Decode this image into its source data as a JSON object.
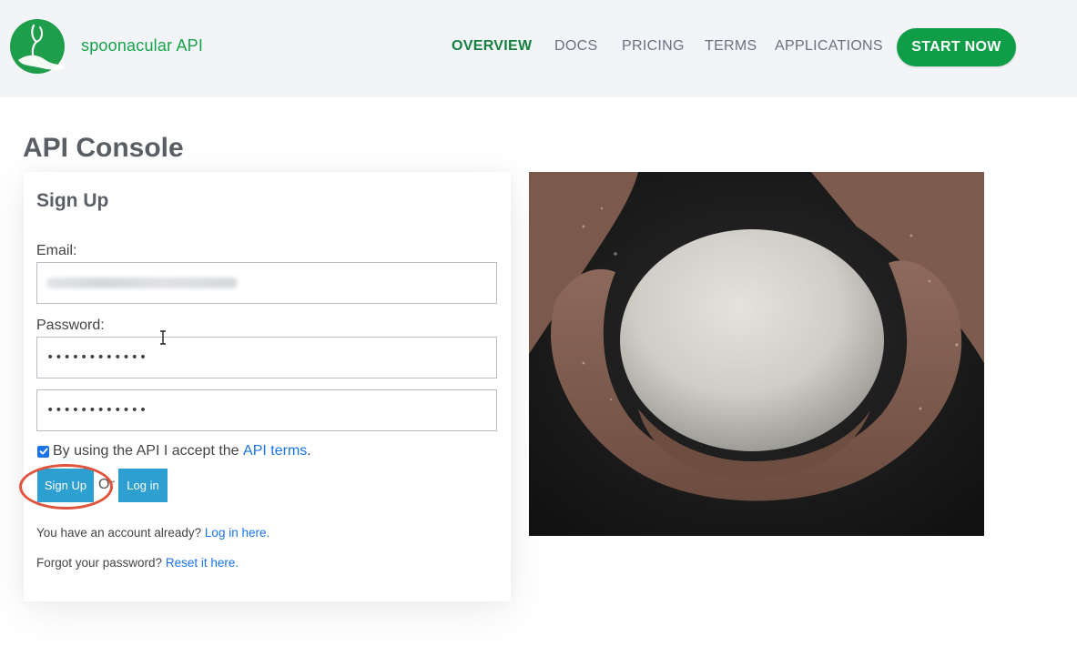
{
  "header": {
    "brand": "spoonacular API",
    "nav": [
      {
        "label": "OVERVIEW",
        "active": true
      },
      {
        "label": "DOCS",
        "active": false
      },
      {
        "label": "PRICING",
        "active": false
      },
      {
        "label": "TERMS",
        "active": false
      },
      {
        "label": "APPLICATIONS",
        "active": false
      }
    ],
    "cta_label": "START NOW"
  },
  "page": {
    "title": "API Console"
  },
  "signup": {
    "title": "Sign Up",
    "email_label": "Email:",
    "email_value_blurred": true,
    "password_label": "Password:",
    "password_value": "••••••••••••",
    "password_confirm_value": "••••••••••••",
    "terms_checked": true,
    "terms_text": "By using the API I accept the",
    "terms_link": "API terms",
    "terms_period": ".",
    "signup_button": "Sign Up",
    "or_text": "Or",
    "login_button": "Log in",
    "have_account_text": "You have an account already?",
    "have_account_link": "Log in here.",
    "forgot_text": "Forgot your password?",
    "forgot_link": "Reset it here."
  },
  "image": {
    "subject": "hands-holding-dough-ball"
  },
  "colors": {
    "brand_green": "#15803d",
    "cta_green": "#0f9d48",
    "button_blue": "#2d9fd1",
    "link_blue": "#1a73e8",
    "highlight_red": "#e0533d"
  }
}
